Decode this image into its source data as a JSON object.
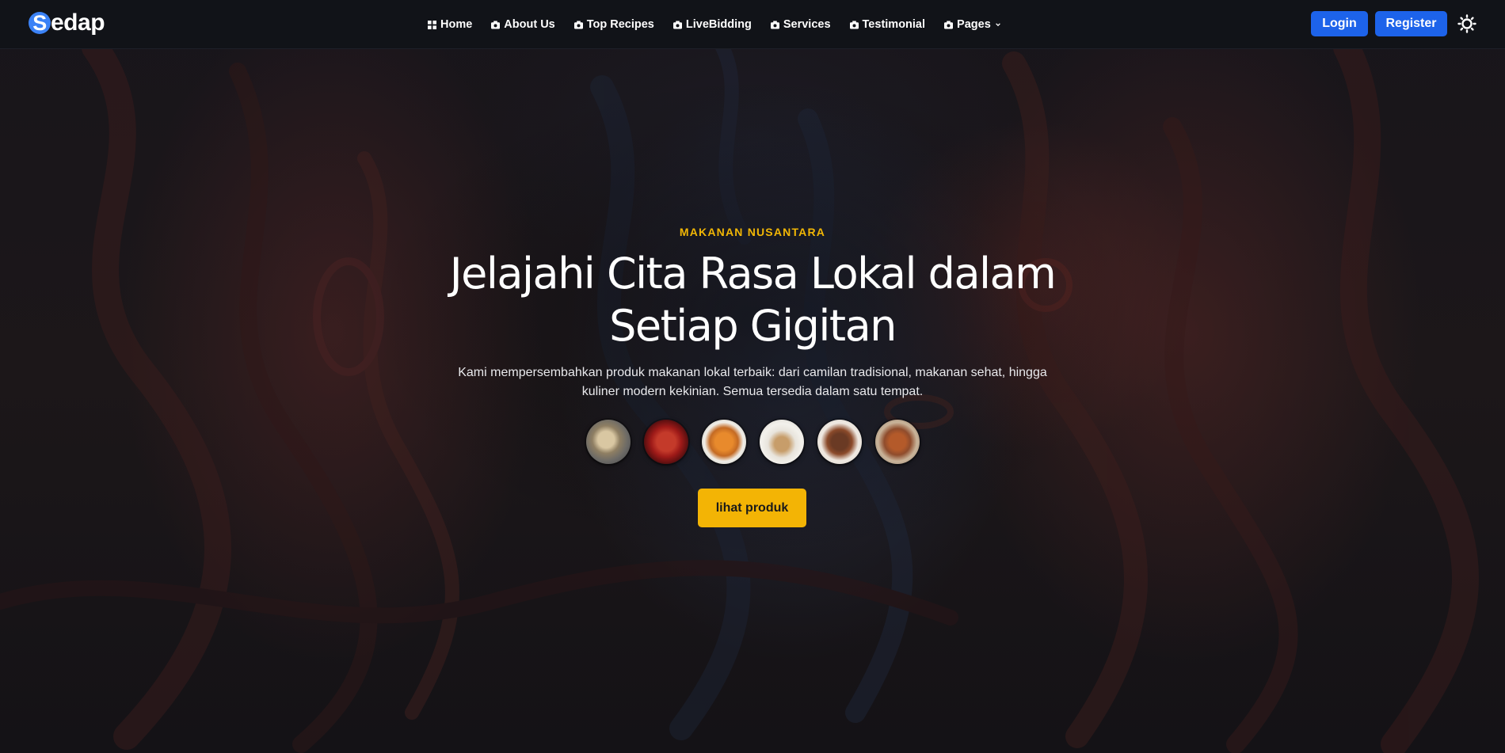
{
  "brand": {
    "initial": "S",
    "rest": "edap"
  },
  "nav": {
    "items": [
      {
        "label": "Home",
        "icon": "grid-icon"
      },
      {
        "label": "About Us",
        "icon": "camera-icon"
      },
      {
        "label": "Top Recipes",
        "icon": "camera-icon"
      },
      {
        "label": "LiveBidding",
        "icon": "camera-icon"
      },
      {
        "label": "Services",
        "icon": "camera-icon"
      },
      {
        "label": "Testimonial",
        "icon": "camera-icon"
      },
      {
        "label": "Pages",
        "icon": "camera-icon",
        "dropdown": true
      }
    ]
  },
  "auth": {
    "login_label": "Login",
    "register_label": "Register"
  },
  "theme_toggle": {
    "icon": "sun-icon"
  },
  "hero": {
    "eyebrow": "MAKANAN NUSANTARA",
    "headline_line1": "Jelajahi Cita Rasa Lokal dalam",
    "headline_line2": "Setiap Gigitan",
    "subtext_line1": "Kami mempersembahkan produk makanan lokal terbaik: dari camilan tradisional, makanan sehat, hingga",
    "subtext_line2": "kuliner modern kekinian. Semua tersedia dalam satu tempat.",
    "product_thumbnails": 6,
    "cta_label": "lihat produk"
  },
  "colors": {
    "accent": "#f3b405",
    "primary_button": "#1d63ea",
    "navbar_bg": "#111318",
    "brand_circle": "#3b82f6"
  }
}
